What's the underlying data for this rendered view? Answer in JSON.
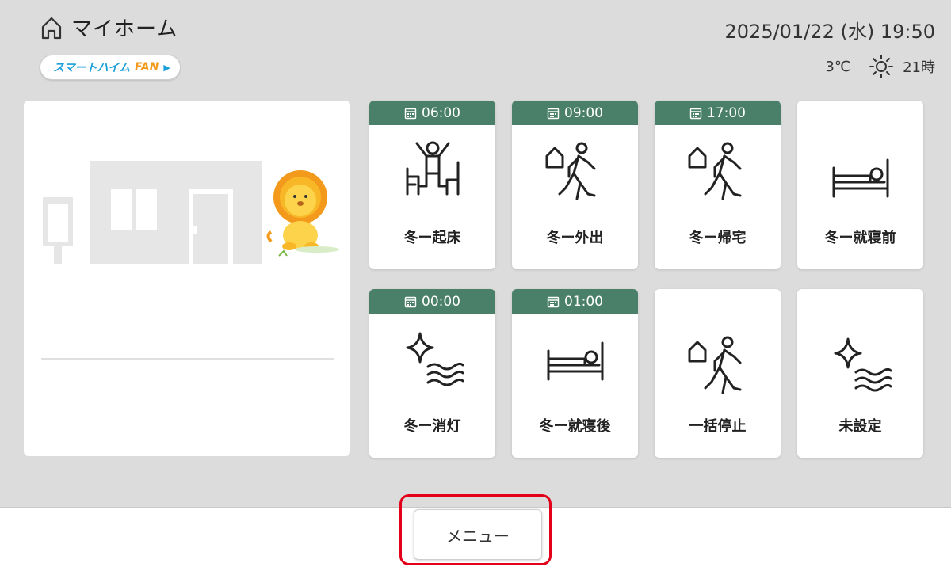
{
  "header": {
    "title": "マイホーム",
    "fan_badge": {
      "part_a": "スマートハイム",
      "part_b": "FAN"
    },
    "datetime": "2025/01/22 (水) 19:50",
    "temperature": "3℃",
    "weather_icon": "sun-icon",
    "hour": "21時"
  },
  "scenes": [
    {
      "time": "06:00",
      "label": "冬ー起床",
      "icon": "wake-up-icon"
    },
    {
      "time": "09:00",
      "label": "冬ー外出",
      "icon": "going-out-icon"
    },
    {
      "time": "17:00",
      "label": "冬ー帰宅",
      "icon": "return-home-icon"
    },
    {
      "time": "",
      "label": "冬ー就寝前",
      "icon": "bed-icon"
    },
    {
      "time": "00:00",
      "label": "冬ー消灯",
      "icon": "sparkle-wave-icon"
    },
    {
      "time": "01:00",
      "label": "冬ー就寝後",
      "icon": "bed-icon"
    },
    {
      "time": "",
      "label": "一括停止",
      "icon": "going-out-icon"
    },
    {
      "time": "",
      "label": "未設定",
      "icon": "sparkle-wave-icon"
    }
  ],
  "footer": {
    "menu_label": "メニュー"
  },
  "colors": {
    "accent_green": "#4a8069",
    "highlight_red": "#e3001b",
    "background": "#dcdcdc"
  }
}
